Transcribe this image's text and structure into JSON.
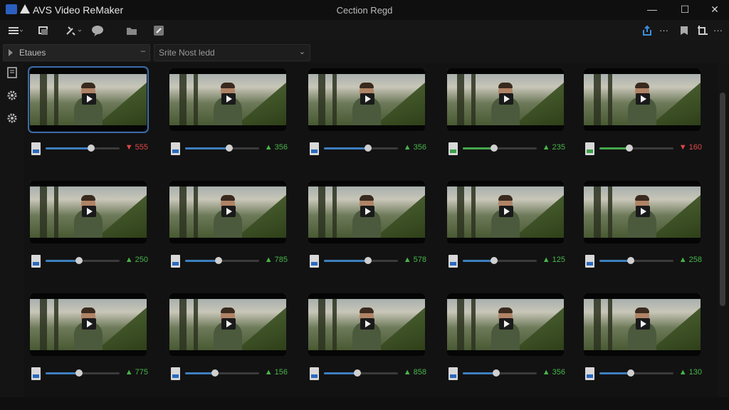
{
  "window": {
    "app_title": "AVS Video ReMaker",
    "doc_title": "Cection Regd",
    "minimize_glyph": "—",
    "maximize_glyph": "☐",
    "close_glyph": "✕"
  },
  "toolbar": {
    "more_left": "···",
    "more_right": "···"
  },
  "filters": {
    "status_label": "Etaues",
    "sort_label": "Srite Nost ledd"
  },
  "colors": {
    "accent_blue": "#3d7fbf",
    "accent_green": "#44a84c",
    "stat_up": "#47b54a",
    "stat_down": "#e04848"
  },
  "clips": [
    {
      "stat": "▼ 555",
      "trend": "down",
      "progress": 0.62,
      "green": false
    },
    {
      "stat": "▲ 356",
      "trend": "up",
      "progress": 0.6,
      "green": false
    },
    {
      "stat": "▲ 356",
      "trend": "up",
      "progress": 0.6,
      "green": false
    },
    {
      "stat": "▲ 235",
      "trend": "up",
      "progress": 0.42,
      "green": true
    },
    {
      "stat": "▼ 160",
      "trend": "down",
      "progress": 0.4,
      "green": true
    },
    {
      "stat": "▲ 250",
      "trend": "up",
      "progress": 0.45,
      "green": false
    },
    {
      "stat": "▲ 785",
      "trend": "up",
      "progress": 0.45,
      "green": false
    },
    {
      "stat": "▲ 578",
      "trend": "up",
      "progress": 0.6,
      "green": false
    },
    {
      "stat": "▲ 125",
      "trend": "up",
      "progress": 0.42,
      "green": false
    },
    {
      "stat": "▲ 258",
      "trend": "up",
      "progress": 0.42,
      "green": false
    },
    {
      "stat": "▲ 775",
      "trend": "up",
      "progress": 0.45,
      "green": false
    },
    {
      "stat": "▲ 156",
      "trend": "up",
      "progress": 0.4,
      "green": false
    },
    {
      "stat": "▲ 858",
      "trend": "up",
      "progress": 0.45,
      "green": false
    },
    {
      "stat": "▲ 356",
      "trend": "up",
      "progress": 0.45,
      "green": false
    },
    {
      "stat": "▲ 130",
      "trend": "up",
      "progress": 0.42,
      "green": false
    }
  ]
}
